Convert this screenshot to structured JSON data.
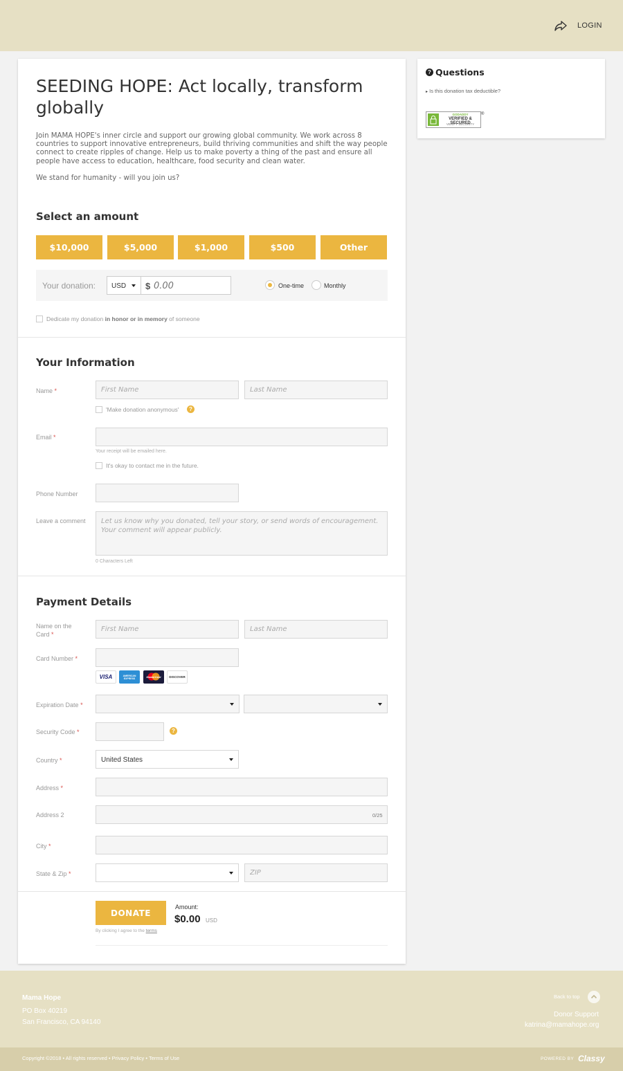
{
  "header": {
    "share_icon": "share-arrow-icon",
    "login_label": "LOGIN"
  },
  "campaign": {
    "title": "SEEDING HOPE: Act locally, transform globally",
    "description": "Join MAMA HOPE's inner circle and support our growing global community. We work across 8 countries to support innovative entrepreneurs, build thriving communities and shift the way people connect to create ripples of change. Help us to make poverty a thing of the past and ensure all people have access to education, healthcare, food security and clean water.",
    "tagline": "We stand for humanity - will you join us?"
  },
  "amount": {
    "heading": "Select an amount",
    "options": [
      "$10,000",
      "$5,000",
      "$1,000",
      "$500",
      "Other"
    ],
    "your_donation_label": "Your donation:",
    "currency": "USD",
    "currency_symbol": "$",
    "amount_placeholder": "0.00",
    "frequency": [
      {
        "label": "One-time",
        "selected": true
      },
      {
        "label": "Monthly",
        "selected": false
      }
    ],
    "dedicate_pre": "Dedicate my donation",
    "dedicate_bold": "in honor or in memory",
    "dedicate_post": "of someone"
  },
  "info": {
    "heading": "Your Information",
    "name_label": "Name",
    "required_mark": "*",
    "first_name_placeholder": "First Name",
    "last_name_placeholder": "Last Name",
    "anonymous_label": "'Make donation anonymous'",
    "help_glyph": "?",
    "email_label": "Email",
    "email_hint": "Your receipt will be emailed here.",
    "contact_label": "It's okay to contact me in the future.",
    "phone_label": "Phone Number",
    "comment_label": "Leave a comment",
    "comment_placeholder": "Let us know why you donated, tell your story, or send words of encouragement. Your comment will appear publicly.",
    "chars_left": "0 Characters Left"
  },
  "payment": {
    "heading": "Payment Details",
    "name_on_card_label": "Name on the Card",
    "first_name_placeholder": "First Name",
    "last_name_placeholder": "Last Name",
    "card_number_label": "Card Number",
    "card_brands": [
      "VISA",
      "AMERICAN EXPRESS",
      "MasterCard",
      "DISCOVER"
    ],
    "expiration_label": "Expiration Date",
    "security_code_label": "Security Code",
    "country_label": "Country",
    "country_value": "United States",
    "address_label": "Address",
    "address2_label": "Address 2",
    "address2_counter": "0/25",
    "city_label": "City",
    "state_zip_label": "State & Zip",
    "zip_placeholder": "ZIP"
  },
  "submit": {
    "donate_label": "DONATE",
    "amount_label": "Amount:",
    "amount_value": "$0.00",
    "amount_currency": "USD",
    "terms_pre": "By clicking I agree to the",
    "terms_link": "terms"
  },
  "sidebar": {
    "questions_title": "Questions",
    "question_items": [
      "Is this donation tax deductible?"
    ],
    "seal_line1": "GODADDY",
    "seal_line2": "VERIFIED & SECURED",
    "seal_line3": "VERIFY SECURITY",
    "seal_mark": "®"
  },
  "footer": {
    "org_name": "Mama Hope",
    "address_line1": "PO Box 40219",
    "address_line2": "San Francisco, CA 94140",
    "back_to_top": "Back to top",
    "donor_support": "Donor Support",
    "email": "katrina@mamahope.org",
    "copyright": "Copyright ©2018 • All rights reserved •",
    "privacy": "Privacy Policy",
    "separator": "•",
    "terms": "Terms of Use",
    "powered_by": "POWERED BY",
    "brand": "Classy"
  },
  "colors": {
    "accent": "#ebb640",
    "header_bg": "#e6e0c4",
    "footer_bottom_bg": "#d7ceaa"
  }
}
